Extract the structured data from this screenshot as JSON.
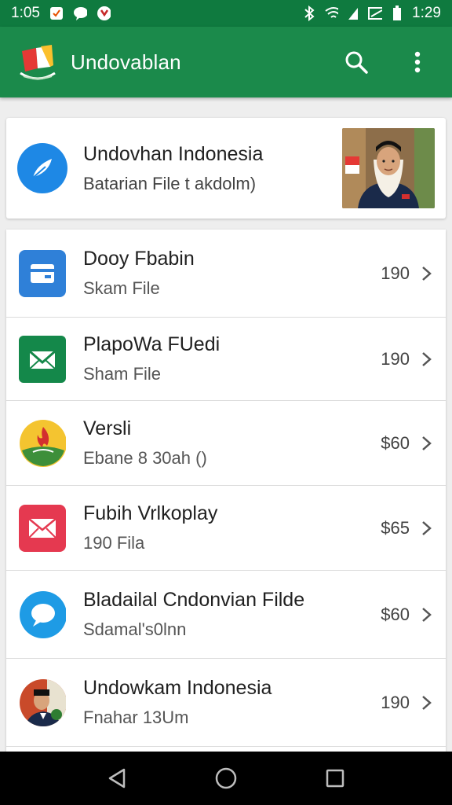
{
  "status_bar": {
    "time_left": "1:05",
    "time_right": "1:29"
  },
  "app_bar": {
    "title": "Undovablan",
    "actions": [
      "search-icon",
      "more-vert-icon"
    ]
  },
  "header_card": {
    "title": "Undovhan Indonesia",
    "subtitle": "Batarian File t akdolm)",
    "icon_color": "#1e88e5"
  },
  "list": {
    "items": [
      {
        "title": "Dooy Fbabin",
        "subtitle": "Skam File",
        "value": "190",
        "icon": "wallet-icon",
        "icon_color": "#2f80d8"
      },
      {
        "title": "PlapoWa FUedi",
        "subtitle": "Sham File",
        "value": "190",
        "icon": "mail-icon",
        "icon_color": "#14884a"
      },
      {
        "title": "Versli",
        "subtitle": "Ebane 8 30ah ()",
        "value": "$60",
        "icon": "flame-logo-icon",
        "icon_color": "#3d8f3a"
      },
      {
        "title": "Fubih Vrlkoplay",
        "subtitle": "190 Fila",
        "value": "$65",
        "icon": "envelope-icon",
        "icon_color": "#e53950"
      },
      {
        "title": "Bladailal Cndonvian Filde",
        "subtitle": "Sdamal's0lnn",
        "value": "$60",
        "icon": "chat-icon",
        "icon_color": "#1e9be5"
      },
      {
        "title": "Undowkam Indonesia",
        "subtitle": "Fnahar 13Um",
        "value": "190",
        "icon": "avatar-icon",
        "icon_color": "#c94a2a"
      }
    ]
  },
  "nav_bar": {
    "buttons": [
      "back-icon",
      "home-icon",
      "recents-icon"
    ]
  },
  "colors": {
    "app_bar": "#1b8a4b",
    "status_bar": "#0f7a3f"
  }
}
